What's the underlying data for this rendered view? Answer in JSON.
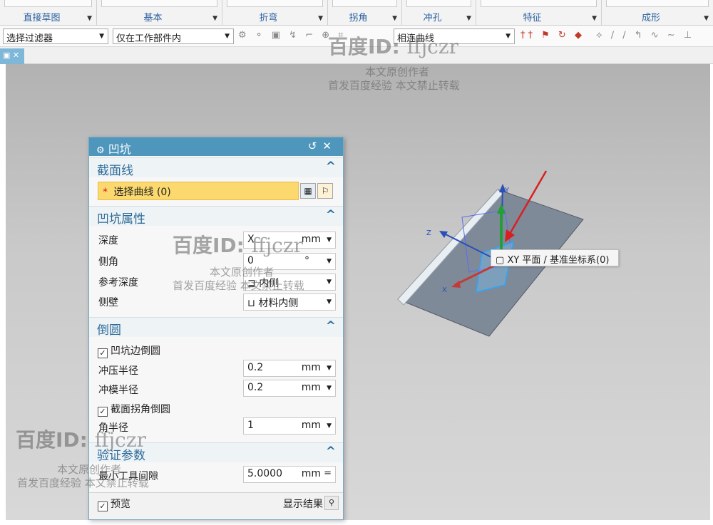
{
  "ribbon": {
    "groups": [
      {
        "label": "直接草图"
      },
      {
        "label": "基本"
      },
      {
        "label": "折弯"
      },
      {
        "label": "拐角"
      },
      {
        "label": "冲孔"
      },
      {
        "label": "特征"
      },
      {
        "label": "成形"
      }
    ]
  },
  "selection_bar": {
    "filter": "选择过滤器",
    "scope": "仅在工作部件内",
    "curve_rule": "相连曲线"
  },
  "icons": {
    "dialog": "gear-icon",
    "reset": "reset-icon",
    "close": "close-icon",
    "collapse": "caret-up-icon",
    "dropdown": "chevron-down-icon",
    "select_curve": "curve-select-icon",
    "sketch": "sketch-section-icon",
    "inside": "inside-direction-icon",
    "material": "material-inside-icon",
    "search": "magnifier-icon",
    "checkbox": "checkbox-checked-icon",
    "datum": "plane-icon"
  },
  "colors": {
    "accent": "#4f96bc",
    "selection_highlight": "#fbd96f",
    "section_text": "#2d6b99",
    "required_star": "#d11b1b"
  },
  "dialog": {
    "title": "凹坑",
    "sections": {
      "section_curve": {
        "title": "截面线",
        "select_label": "选择曲线 (0)",
        "required_mark": "*"
      },
      "properties": {
        "title": "凹坑属性",
        "depth_label": "深度",
        "depth_value": "X",
        "depth_unit": "mm",
        "side_angle_label": "侧角",
        "side_angle_value": "0",
        "side_angle_unit": "°",
        "ref_depth_label": "参考深度",
        "ref_depth_value": "内侧",
        "side_wall_label": "侧壁",
        "side_wall_value": "材料内侧"
      },
      "rounding": {
        "title": "倒圆",
        "round_edge_label": "凹坑边倒圆",
        "round_edge_checked": true,
        "punch_radius_label": "冲压半径",
        "punch_radius_value": "0.2",
        "punch_radius_unit": "mm",
        "die_radius_label": "冲模半径",
        "die_radius_value": "0.2",
        "die_radius_unit": "mm",
        "section_corner_label": "截面拐角倒圆",
        "section_corner_checked": true,
        "corner_radius_label": "角半径",
        "corner_radius_value": "1",
        "corner_radius_unit": "mm"
      },
      "validation": {
        "title": "验证参数",
        "min_gap_label": "最小工具间隙",
        "min_gap_value": "5.0000",
        "min_gap_unit": "mm",
        "min_gap_op": "="
      }
    },
    "preview_label": "预览",
    "preview_checked": true,
    "show_result_label": "显示结果"
  },
  "viewport": {
    "tooltip": "XY 平面 / 基准坐标系(0)",
    "axes": {
      "x": "X",
      "y": "Y",
      "z": "Z"
    }
  },
  "watermarks": {
    "brand": "百度ID:",
    "id": "ffjczr",
    "line1": "本文原创作者",
    "line2": "首发百度经验   本文禁止转载"
  }
}
